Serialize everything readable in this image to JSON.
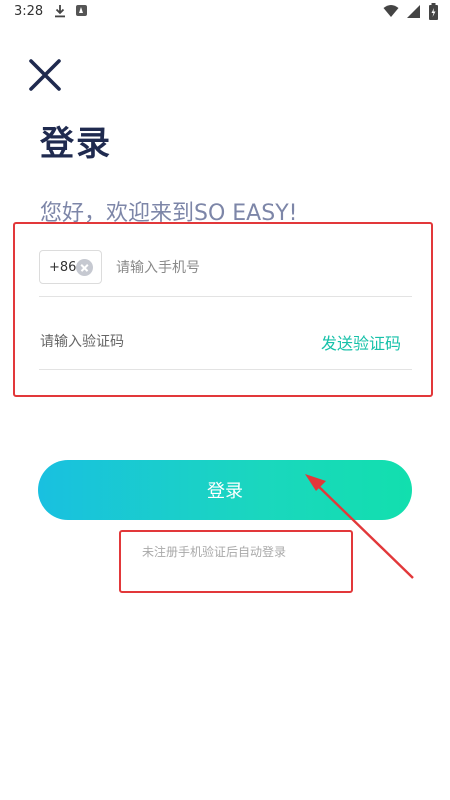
{
  "status_bar": {
    "time": "3:28"
  },
  "header": {
    "title": "登录",
    "welcome": "您好，欢迎来到SO EASY!"
  },
  "phone": {
    "country_code": "+86",
    "placeholder": "请输入手机号"
  },
  "verify": {
    "placeholder": "请输入验证码",
    "send_code_label": "发送验证码"
  },
  "login": {
    "button_label": "登录",
    "hint": "未注册手机验证后自动登录"
  },
  "colors": {
    "accent": "#17c1a9",
    "title": "#1f2a4f",
    "annotation": "#e2383a"
  }
}
